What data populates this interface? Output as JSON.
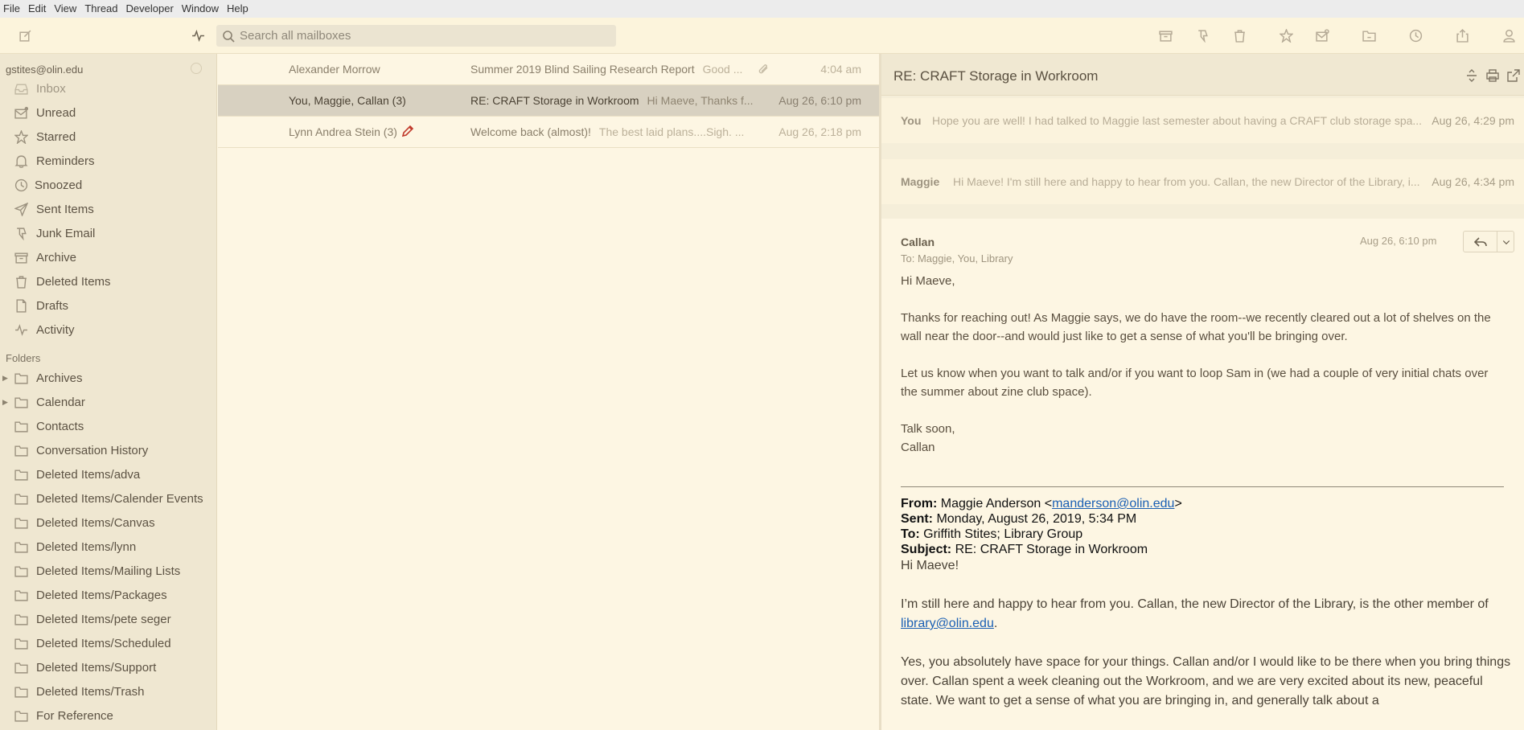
{
  "menubar": {
    "items": [
      "File",
      "Edit",
      "View",
      "Thread",
      "Developer",
      "Window",
      "Help"
    ]
  },
  "toolbar": {
    "search_placeholder": "Search all mailboxes",
    "icons": [
      "compose-icon",
      "activity-icon",
      "archive-icon",
      "junk-icon",
      "trash-icon",
      "star-icon",
      "remind-icon",
      "move-icon",
      "snooze-icon",
      "share-icon",
      "account-icon"
    ]
  },
  "sidebar": {
    "account": "gstites@olin.edu",
    "mailboxes": [
      {
        "label": "Inbox",
        "icon": "inbox-icon"
      },
      {
        "label": "Unread",
        "icon": "unread-icon"
      },
      {
        "label": "Starred",
        "icon": "star-icon"
      },
      {
        "label": "Reminders",
        "icon": "bell-icon"
      },
      {
        "label": "Snoozed",
        "icon": "clock-icon"
      },
      {
        "label": "Sent Items",
        "icon": "send-icon"
      },
      {
        "label": "Junk Email",
        "icon": "thumbs-down-icon"
      },
      {
        "label": "Archive",
        "icon": "archive-icon"
      },
      {
        "label": "Deleted Items",
        "icon": "trash-icon"
      },
      {
        "label": "Drafts",
        "icon": "draft-icon"
      },
      {
        "label": "Activity",
        "icon": "activity-icon"
      }
    ],
    "folders_heading": "Folders",
    "folders": [
      {
        "label": "Archives",
        "expandable": true
      },
      {
        "label": "Calendar",
        "expandable": true
      },
      {
        "label": "Contacts",
        "expandable": false
      },
      {
        "label": "Conversation History",
        "expandable": false
      },
      {
        "label": "Deleted Items/adva",
        "expandable": false
      },
      {
        "label": "Deleted Items/Calender Events",
        "expandable": false
      },
      {
        "label": "Deleted Items/Canvas",
        "expandable": false
      },
      {
        "label": "Deleted Items/lynn",
        "expandable": false
      },
      {
        "label": "Deleted Items/Mailing Lists",
        "expandable": false
      },
      {
        "label": "Deleted Items/Packages",
        "expandable": false
      },
      {
        "label": "Deleted Items/pete seger",
        "expandable": false
      },
      {
        "label": "Deleted Items/Scheduled",
        "expandable": false
      },
      {
        "label": "Deleted Items/Support",
        "expandable": false
      },
      {
        "label": "Deleted Items/Trash",
        "expandable": false
      },
      {
        "label": "For Reference",
        "expandable": false
      }
    ]
  },
  "messages": [
    {
      "sender": "Alexander Morrow",
      "subject": "Summer 2019 Blind Sailing Research Report",
      "preview": "Good ...",
      "time": "4:04 am",
      "attachment": true,
      "selected": false
    },
    {
      "sender": "You, Maggie, Callan (3)",
      "subject": "RE: CRAFT Storage in Workroom",
      "preview": "Hi Maeve, Thanks f...",
      "time": "Aug 26, 6:10 pm",
      "attachment": false,
      "selected": true
    },
    {
      "sender": "Lynn Andrea Stein (3)",
      "subject": "Welcome back (almost)!",
      "preview": "The best laid plans....Sigh. ...",
      "time": "Aug 26, 2:18 pm",
      "attachment": false,
      "selected": false,
      "draft": true
    }
  ],
  "reader": {
    "title": "RE: CRAFT Storage in Workroom",
    "collapsed": [
      {
        "sender": "You",
        "preview": "Hope you are well! I had talked to Maggie last semester about having a CRAFT club storage spa...",
        "time": "Aug 26, 4:29 pm"
      },
      {
        "sender": "Maggie",
        "preview": "Hi Maeve! I'm still here and happy to hear from you. Callan, the new Director of the Library, i...",
        "time": "Aug 26, 4:34 pm"
      }
    ],
    "open": {
      "from": "Callan",
      "to": "To: Maggie, You, Library",
      "time": "Aug 26, 6:10 pm",
      "body": [
        "Hi Maeve,",
        "Thanks for reaching out! As Maggie says, we do have the room--we recently cleared out a lot of shelves on the wall near the door--and would just like to get a sense of what you'll be bringing over.",
        "Let us know when you want to talk and/or if you want to loop Sam in (we had a couple of very initial chats over the summer about zine club space).",
        "Talk soon,",
        "Callan"
      ],
      "quoted_header": {
        "from_label": "From:",
        "from_name": " Maggie Anderson <",
        "from_email": "manderson@olin.edu",
        "from_close": ">",
        "sent_label": "Sent:",
        "sent": " Monday, August 26, 2019, 5:34 PM",
        "to_label": "To:",
        "to": " Griffith Stites; Library Group",
        "subject_label": "Subject:",
        "subject": " RE: CRAFT Storage in Workroom"
      },
      "quoted_greeting": "Hi Maeve!",
      "quoted_p1_a": "I’m still here and happy to hear from you. Callan, the new Director of the Library, is the other member of ",
      "quoted_p1_link": "library@olin.edu",
      "quoted_p1_b": ".",
      "quoted_p2": "Yes, you absolutely have space for your things. Callan and/or I would like to be there when you bring things over. Callan spent a week cleaning out the Workroom, and we are very excited about its new, peaceful state. We want to get a sense of what you are bringing in, and generally talk about a"
    }
  }
}
